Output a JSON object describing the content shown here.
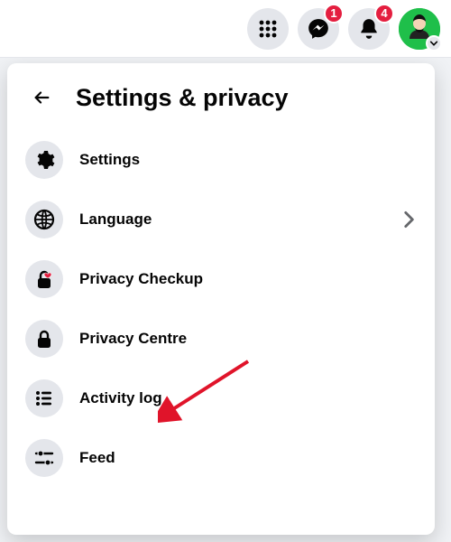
{
  "topbar": {
    "messenger_badge": "1",
    "notifications_badge": "4"
  },
  "panel": {
    "title": "Settings & privacy"
  },
  "menu": {
    "items": [
      {
        "label": "Settings",
        "icon": "gear-icon",
        "has_chevron": false
      },
      {
        "label": "Language",
        "icon": "globe-icon",
        "has_chevron": true
      },
      {
        "label": "Privacy Checkup",
        "icon": "lock-heart-icon",
        "has_chevron": false
      },
      {
        "label": "Privacy Centre",
        "icon": "lock-icon",
        "has_chevron": false
      },
      {
        "label": "Activity log",
        "icon": "list-icon",
        "has_chevron": false
      },
      {
        "label": "Feed",
        "icon": "sliders-icon",
        "has_chevron": false
      }
    ]
  }
}
